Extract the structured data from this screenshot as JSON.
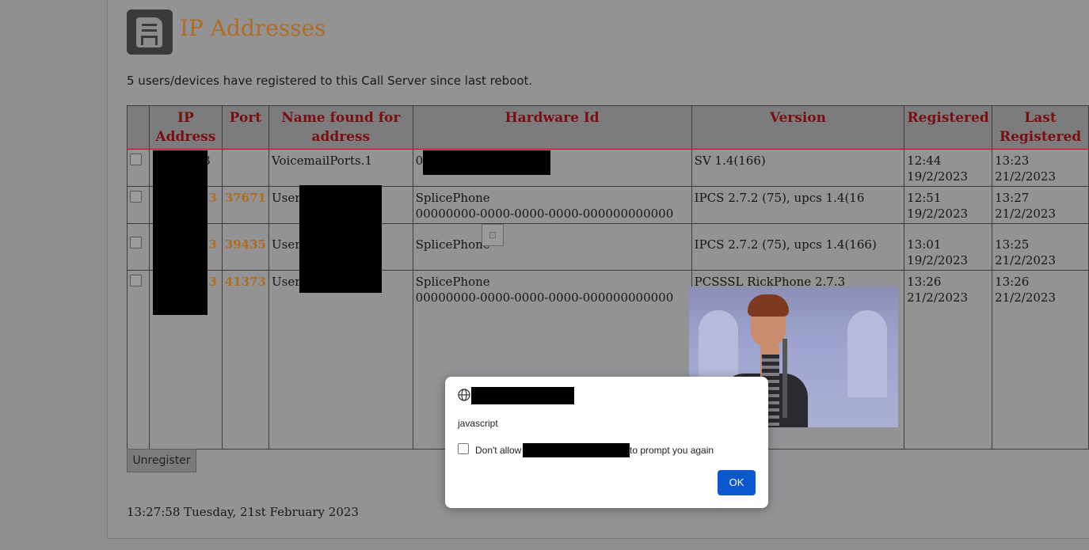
{
  "page": {
    "title": "IP Addresses",
    "subtitle": "5 users/devices have registered to this Call Server since last reboot.",
    "footer_time": "13:27:58 Tuesday, 21st February 2023",
    "unregister_label": "Unregister"
  },
  "table": {
    "headers": [
      "IP Address",
      "Port",
      "Name found for address",
      "Hardware Id",
      "Version",
      "Registered",
      "Last Registered"
    ],
    "rows": [
      {
        "ip_tail": "3",
        "port": "",
        "name": "VoicemailPorts.1",
        "hwid_line1": "00",
        "hwid_line2": "",
        "version": "SV 1.4(166)",
        "registered_time": "12:44",
        "registered_date": "19/2/2023",
        "last_registered": "13:23 21/2/2023"
      },
      {
        "ip_tail": "3",
        "port": "37671",
        "name": "Users.",
        "hwid_line1": "SplicePhone",
        "hwid_line2": "00000000-0000-0000-0000-000000000000",
        "version": "IPCS 2.7.2 (75), upcs 1.4(16",
        "registered_time": "12:51",
        "registered_date": "19/2/2023",
        "last_registered": "13:27 21/2/2023"
      },
      {
        "ip_tail": "3",
        "port": "39435",
        "name": "Users.",
        "hwid_line1": "SplicePhone",
        "hwid_line2": "",
        "version": "IPCS 2.7.2 (75), upcs 1.4(166)",
        "registered_time": "13:01",
        "registered_date": "19/2/2023",
        "last_registered": "13:25 21/2/2023"
      },
      {
        "ip_tail": "3",
        "port": "41373",
        "name": "Users.",
        "hwid_line1": "SplicePhone",
        "hwid_line2": "00000000-0000-0000-0000-000000000000",
        "version": "PCSSSL RickPhone 2.7.3",
        "registered_time": "13:26",
        "registered_date": "21/2/2023",
        "last_registered": "13:26 21/2/2023"
      }
    ]
  },
  "dialog": {
    "message": "javascript",
    "checkbox_prefix": "Don't allow",
    "checkbox_suffix": "to prompt you again",
    "ok_label": "OK"
  },
  "colors": {
    "accent": "#b06d20",
    "header_text": "#7a0f10",
    "ok_button": "#0b57d0"
  }
}
